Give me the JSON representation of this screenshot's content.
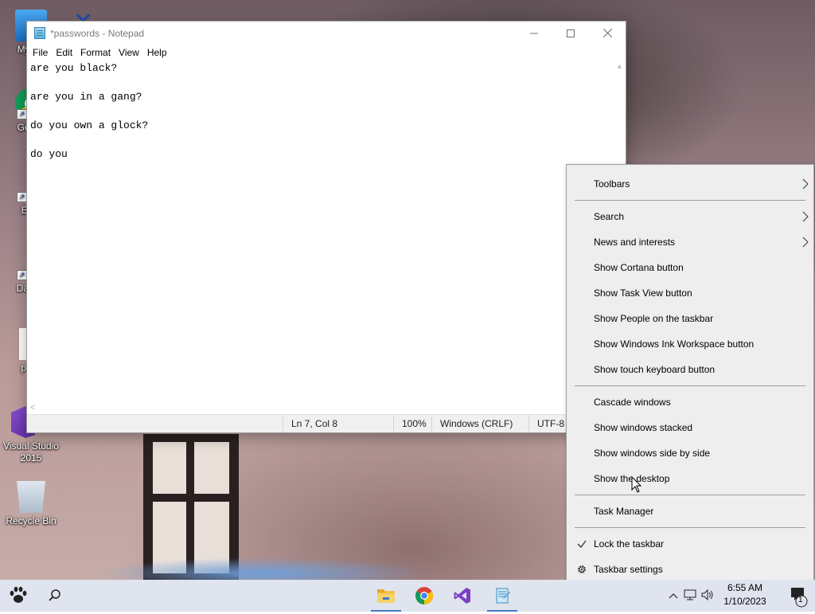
{
  "desktop": {
    "icons": [
      {
        "label": "My Co"
      },
      {
        "label": "Go Ch"
      },
      {
        "label": "Ever"
      },
      {
        "label": "DataW"
      },
      {
        "label": "pass"
      },
      {
        "label": "Visual Studio 2015"
      },
      {
        "label": "Recycle Bin"
      }
    ]
  },
  "notepad": {
    "title": "*passwords - Notepad",
    "menu": [
      "File",
      "Edit",
      "Format",
      "View",
      "Help"
    ],
    "lines": [
      "are you black?",
      "",
      "are you in a gang?",
      "",
      "do you own a glock?",
      "",
      "do you"
    ],
    "status": {
      "position": "Ln 7, Col 8",
      "zoom": "100%",
      "line_ending": "Windows (CRLF)",
      "encoding": "UTF-8"
    }
  },
  "context_menu": {
    "items": [
      {
        "label": "Toolbars",
        "submenu": true
      },
      {
        "label": "Search",
        "submenu": true
      },
      {
        "label": "News and interests",
        "submenu": true
      },
      {
        "label": "Show Cortana button"
      },
      {
        "label": "Show Task View button"
      },
      {
        "label": "Show People on the taskbar"
      },
      {
        "label": "Show Windows Ink Workspace button"
      },
      {
        "label": "Show touch keyboard button"
      },
      {
        "label": "Cascade windows"
      },
      {
        "label": "Show windows stacked"
      },
      {
        "label": "Show windows side by side"
      },
      {
        "label": "Show the desktop"
      },
      {
        "label": "Task Manager"
      },
      {
        "label": "Lock the taskbar",
        "checked": true
      },
      {
        "label": "Taskbar settings",
        "icon": "gear-icon"
      }
    ]
  },
  "taskbar": {
    "clock_time": "6:55 AM",
    "clock_date": "1/10/2023",
    "notification_count": "1",
    "colors": {
      "background": "#dfe4ee",
      "active_indicator": "#4a78c4"
    }
  }
}
